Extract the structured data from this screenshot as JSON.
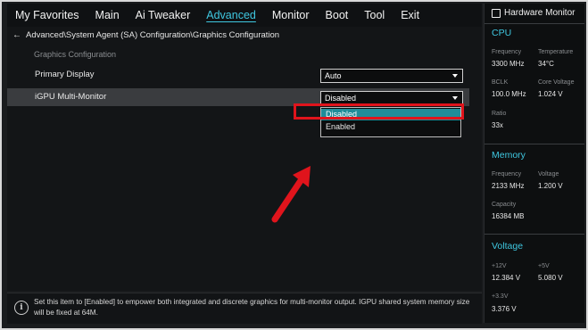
{
  "menu": {
    "items": [
      {
        "label": "My Favorites",
        "active": false
      },
      {
        "label": "Main",
        "active": false
      },
      {
        "label": "Ai Tweaker",
        "active": false
      },
      {
        "label": "Advanced",
        "active": true
      },
      {
        "label": "Monitor",
        "active": false
      },
      {
        "label": "Boot",
        "active": false
      },
      {
        "label": "Tool",
        "active": false
      },
      {
        "label": "Exit",
        "active": false
      }
    ]
  },
  "breadcrumb": "Advanced\\System Agent (SA) Configuration\\Graphics Configuration",
  "section_label": "Graphics Configuration",
  "settings": {
    "primary_display": {
      "label": "Primary Display",
      "value": "Auto"
    },
    "igpu_multi_monitor": {
      "label": "iGPU Multi-Monitor",
      "value": "Disabled"
    }
  },
  "dropdown": {
    "options": [
      "Disabled",
      "Enabled"
    ],
    "selected": "Disabled"
  },
  "info": {
    "text": "Set this item to [Enabled] to empower both integrated and discrete graphics for multi-monitor output. IGPU shared system memory size will be fixed at 64M."
  },
  "hardware_monitor": {
    "title": "Hardware Monitor",
    "cpu": {
      "heading": "CPU",
      "frequency_label": "Frequency",
      "frequency": "3300 MHz",
      "temperature_label": "Temperature",
      "temperature": "34°C",
      "bclk_label": "BCLK",
      "bclk": "100.0 MHz",
      "core_voltage_label": "Core Voltage",
      "core_voltage": "1.024 V",
      "ratio_label": "Ratio",
      "ratio": "33x"
    },
    "memory": {
      "heading": "Memory",
      "frequency_label": "Frequency",
      "frequency": "2133 MHz",
      "voltage_label": "Voltage",
      "voltage": "1.200 V",
      "capacity_label": "Capacity",
      "capacity": "16384 MB"
    },
    "voltage": {
      "heading": "Voltage",
      "v12_label": "+12V",
      "v12": "12.384 V",
      "v5_label": "+5V",
      "v5": "5.080 V",
      "v33_label": "+3.3V",
      "v33": "3.376 V"
    }
  },
  "colors": {
    "accent": "#3fc7e0",
    "selected_option": "#1f8d9a",
    "annotation_red": "#e0141c"
  }
}
